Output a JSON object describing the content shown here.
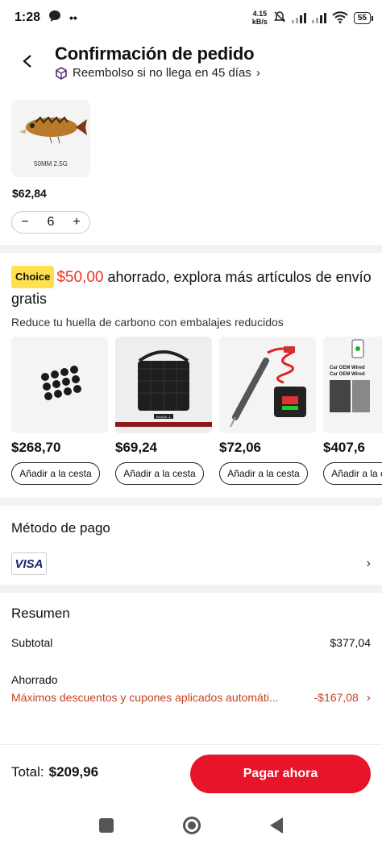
{
  "status_bar": {
    "time": "1:28",
    "net_speed_value": "4.15",
    "net_speed_unit": "kB/s",
    "battery": "55"
  },
  "header": {
    "title": "Confirmación de pedido",
    "refund_text": "Reembolso si no llega en 45 días",
    "refund_chevron": "›"
  },
  "product": {
    "caption": "50MM  2.5G",
    "price": "$62,84",
    "quantity": "6",
    "minus": "−",
    "plus": "+"
  },
  "choice": {
    "badge": "Choice",
    "saved_amount": "$50,00",
    "message": " ahorrado, explora más artículos de envío gratis",
    "carbon_note": "Reduce tu huella de carbono con embalajes reducidos"
  },
  "recommendations": [
    {
      "price": "$268,70",
      "add_label": "Añadir a la cesta",
      "icon": "rubber-caps"
    },
    {
      "price": "$69,24",
      "add_label": "Añadir a la cesta",
      "icon": "seat-organizer",
      "img_label": "BLACK -1"
    },
    {
      "price": "$72,06",
      "add_label": "Añadir a la cesta",
      "icon": "voltage-tester"
    },
    {
      "price": "$407,6",
      "add_label": "Añadir a la cesta",
      "icon": "phone-cable",
      "img_label_1": "Car OEM Wired",
      "img_label_2": "Car OEM Wired"
    }
  ],
  "payment": {
    "title": "Método de pago",
    "card_brand": "VISA",
    "chevron": "›"
  },
  "summary": {
    "title": "Resumen",
    "subtotal_label": "Subtotal",
    "subtotal_value": "$377,04",
    "saved_label": "Ahorrado",
    "saved_note": "Máximos descuentos y cupones aplicados automáti...",
    "saved_value": "-$167,08",
    "saved_chevron": "›"
  },
  "footer": {
    "total_label": "Total:",
    "total_value": "$209,96",
    "pay_button": "Pagar ahora"
  },
  "colors": {
    "accent": "#e8152a",
    "savings": "#c44321",
    "choice_badge": "#ffe14d"
  }
}
